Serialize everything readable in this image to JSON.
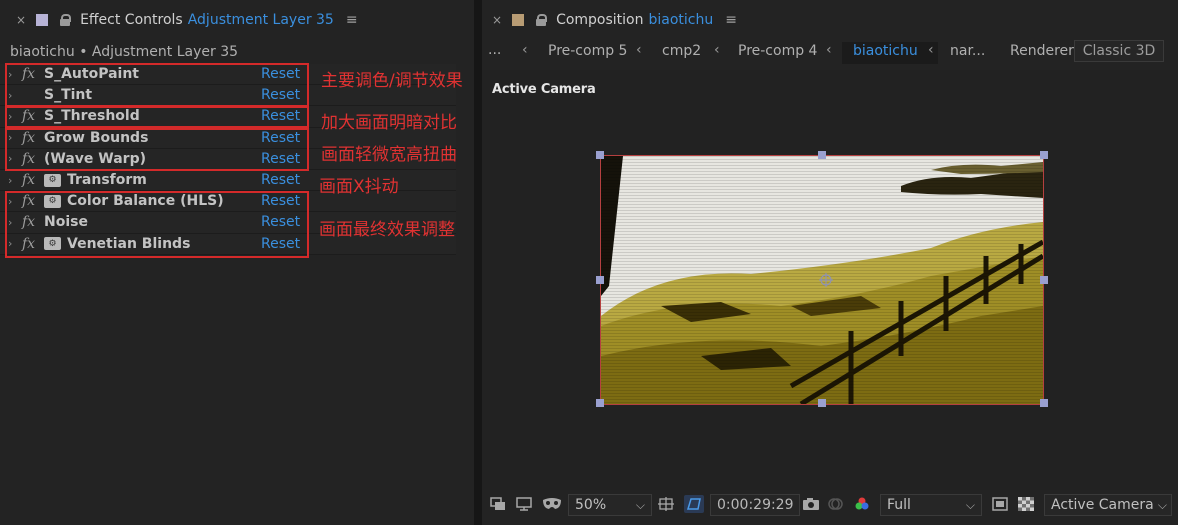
{
  "effect_controls": {
    "close": "×",
    "title": "Effect Controls",
    "layer_name": "Adjustment Layer 35",
    "menu": "≡",
    "breadcrumb": "biaotichu • Adjustment Layer 35",
    "effects": [
      {
        "name": "S_AutoPaint",
        "fx": true,
        "badge": false,
        "reset": "Reset"
      },
      {
        "name": "S_Tint",
        "fx": false,
        "badge": false,
        "reset": "Reset"
      },
      {
        "name": "S_Threshold",
        "fx": true,
        "badge": false,
        "reset": "Reset"
      },
      {
        "name": "Grow Bounds",
        "fx": true,
        "badge": false,
        "reset": "Reset"
      },
      {
        "name": "(Wave Warp)",
        "fx": true,
        "badge": false,
        "reset": "Reset"
      },
      {
        "name": "Transform",
        "fx": true,
        "badge": true,
        "reset": "Reset"
      },
      {
        "name": "Color Balance (HLS)",
        "fx": true,
        "badge": true,
        "reset": "Reset"
      },
      {
        "name": "Noise",
        "fx": true,
        "badge": false,
        "reset": "Reset"
      },
      {
        "name": "Venetian Blinds",
        "fx": true,
        "badge": true,
        "reset": "Reset"
      }
    ],
    "annotations": [
      "主要调色/调节效果",
      "加大画面明暗对比",
      "画面轻微宽高扭曲",
      "画面X抖动",
      "画面最终效果调整"
    ]
  },
  "composition": {
    "close": "×",
    "title": "Composition",
    "comp_name": "biaotichu",
    "menu": "≡",
    "nav": {
      "ellipsis": "...",
      "items": [
        "Pre-comp 5",
        "cmp2",
        "Pre-comp 4",
        "biaotichu",
        "nar..."
      ],
      "active_index": 3
    },
    "renderer_label": "Renderer:",
    "renderer_value": "Classic 3D",
    "view_label": "Active Camera",
    "bottom": {
      "zoom": "50%",
      "timecode": "0:00:29:29",
      "resolution": "Full",
      "camera": "Active Camera"
    }
  },
  "colors": {
    "accent_blue": "#3a8fde",
    "annotation_red": "#e03232",
    "effect_controls_swatch": "#b7b3d6",
    "composition_swatch": "#b89c74"
  }
}
